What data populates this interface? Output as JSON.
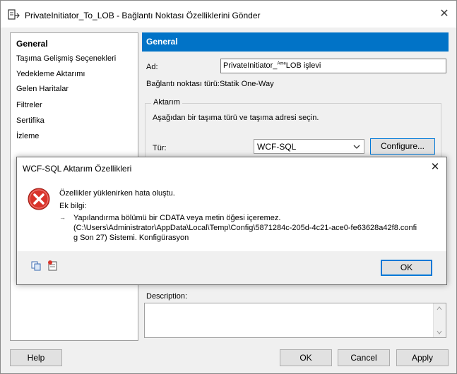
{
  "window": {
    "title": "PrivateInitiator_To_LOB - Bağlantı Noktası Özelliklerini Gönder",
    "close_glyph": "✕"
  },
  "nav": {
    "items": [
      {
        "label": "General"
      },
      {
        "label": "Taşıma Gelişmiş Seçenekleri"
      },
      {
        "label": "Yedekleme Aktarımı"
      },
      {
        "label": "Gelen Haritalar"
      },
      {
        "label": "Filtreler"
      },
      {
        "label": "Sertifika"
      },
      {
        "label": "İzleme"
      }
    ]
  },
  "panel": {
    "header": "General",
    "name_label": "Ad:",
    "name_value_prefix": "PrivateInitiator_",
    "name_value_super": "Ame",
    "name_value_suffix": "LOB işlevi",
    "type_label": "Bağlantı noktası türü:",
    "type_value": "Statik One-Way",
    "group_title": "Aktarım",
    "group_hint": "Aşağıdan bir taşıma türü ve taşıma adresi seçin.",
    "transport_label": "Tür:",
    "transport_value": "WCF-SQL",
    "configure_label": "Configure...",
    "description_label": "Description:",
    "description_value": ""
  },
  "buttons": {
    "help": "Help",
    "ok": "OK",
    "cancel": "Cancel",
    "apply": "Apply"
  },
  "dialog": {
    "title": "WCF-SQL Aktarım Özellikleri",
    "close_glyph": "✕",
    "message": "Özellikler yüklenirken hata oluştu.",
    "extra_label": "Ek bilgi:",
    "arrow": "→",
    "detail_line1": "Yapılandırma bölümü bir CDATA veya metin öğesi içeremez.",
    "detail_line2": "(C:\\Users\\Administrator\\AppData\\Local\\Temp\\Config\\5871284c-205d-4c21-ace0-fe63628a42f8.confi",
    "detail_line3": "g Son 27) Sistemi. Konfigürasyon",
    "ok_label": "OK"
  },
  "colors": {
    "accent": "#0173c7",
    "error_red": "#d9342b"
  },
  "icons": [
    "window-icon",
    "error-icon",
    "copy-icon",
    "details-icon",
    "chevron-down-icon",
    "close-icon"
  ]
}
